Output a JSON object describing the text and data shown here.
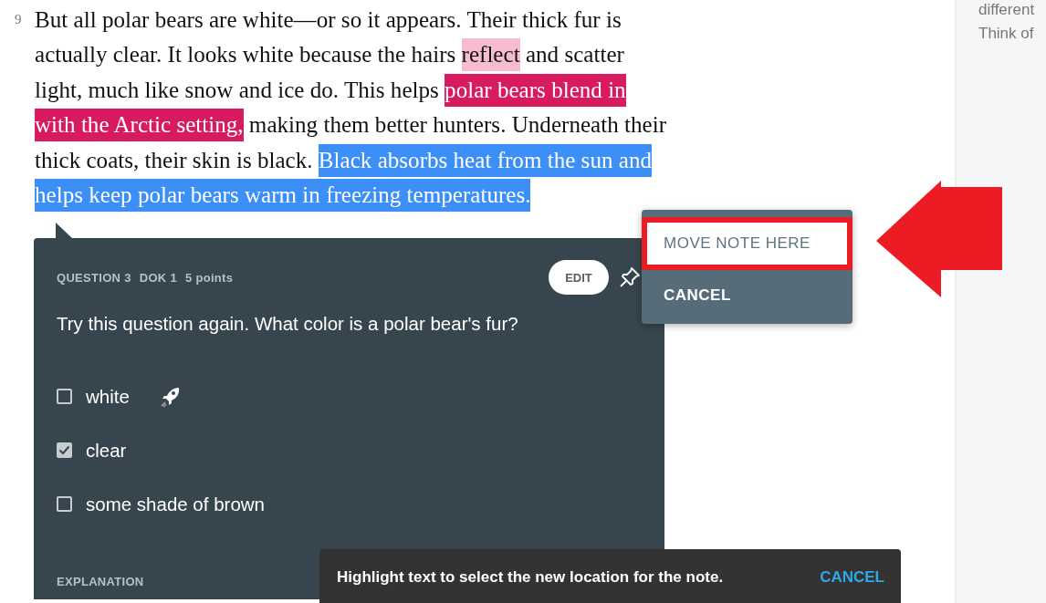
{
  "passage": {
    "line_number": "9",
    "segments": [
      {
        "kind": "plain",
        "text": "But all polar bears are white—or so it appears. Their thick fur is actually clear. It looks white because the hairs "
      },
      {
        "kind": "highlight",
        "color": "#f7bcd0",
        "text": "reflect"
      },
      {
        "kind": "plain",
        "text": " and scatter light, much like snow and ice do. This helps "
      },
      {
        "kind": "note",
        "color": "#d81b60",
        "text": "polar bears blend in with the Arctic setting,"
      },
      {
        "kind": "plain",
        "text": " making them better hunters. Underneath their thick coats, their skin is black. "
      },
      {
        "kind": "selection",
        "color": "#3b8ff7",
        "text": "Black absorbs heat from the sun and helps keep polar bears warm in freezing temperatures."
      }
    ]
  },
  "sidebar": {
    "lines": [
      "different",
      "Think of"
    ]
  },
  "question": {
    "meta": [
      "QUESTION 3",
      "DOK 1",
      "5 points"
    ],
    "edit_button": "EDIT",
    "pinned": false,
    "prompt": "Try this question again. What color is a polar bear's fur?",
    "options": [
      {
        "label": "white",
        "checked": false,
        "boost": true
      },
      {
        "label": "clear",
        "checked": true,
        "boost": false
      },
      {
        "label": "some shade of brown",
        "checked": false,
        "boost": false
      }
    ],
    "explanation_heading": "EXPLANATION"
  },
  "menu": {
    "items": [
      {
        "label": "MOVE NOTE HERE",
        "selected": true
      },
      {
        "label": "CANCEL",
        "selected": false
      }
    ]
  },
  "toast": {
    "message": "Highlight text to select the new location for the note.",
    "action": "CANCEL"
  }
}
